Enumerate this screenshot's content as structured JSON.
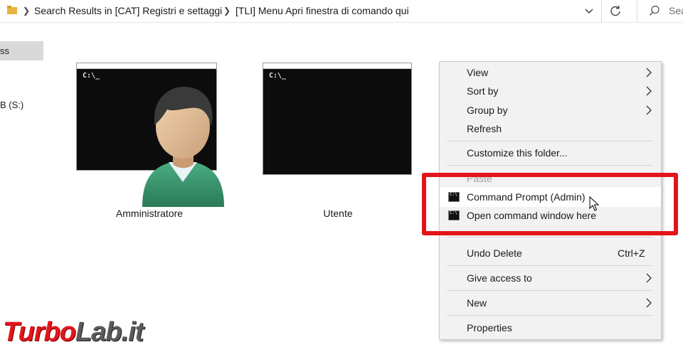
{
  "addressbar": {
    "crumbs": [
      "Search Results in [CAT] Registri e settaggi",
      "[TLI] Menu Apri finestra di comando qui"
    ],
    "search_placeholder": "Sea"
  },
  "sidebar": {
    "items": [
      "ss",
      "B (S:)"
    ]
  },
  "thumbnails": [
    {
      "label": "Amministratore",
      "prompt": "C:\\_"
    },
    {
      "label": "Utente",
      "prompt": "C:\\_"
    }
  ],
  "context_menu": {
    "items": [
      {
        "label": "View",
        "submenu": true
      },
      {
        "label": "Sort by",
        "submenu": true
      },
      {
        "label": "Group by",
        "submenu": true
      },
      {
        "label": "Refresh"
      },
      {
        "label": "Customize this folder..."
      },
      {
        "label": "Paste",
        "disabled": true
      },
      {
        "label": "Command Prompt (Admin)",
        "icon": "cmd-admin-icon"
      },
      {
        "label": "Open command window here",
        "icon": "cmd-icon"
      },
      {
        "label": "Undo Delete",
        "shortcut": "Ctrl+Z"
      },
      {
        "label": "Give access to",
        "submenu": true
      },
      {
        "label": "New",
        "submenu": true
      },
      {
        "label": "Properties"
      }
    ]
  },
  "watermark": {
    "part1": "Turbo",
    "part2": "Lab.it"
  },
  "colors": {
    "highlight": "#e3151a",
    "menu_bg": "#f2f2f2",
    "console_bg": "#0c0c0c"
  }
}
